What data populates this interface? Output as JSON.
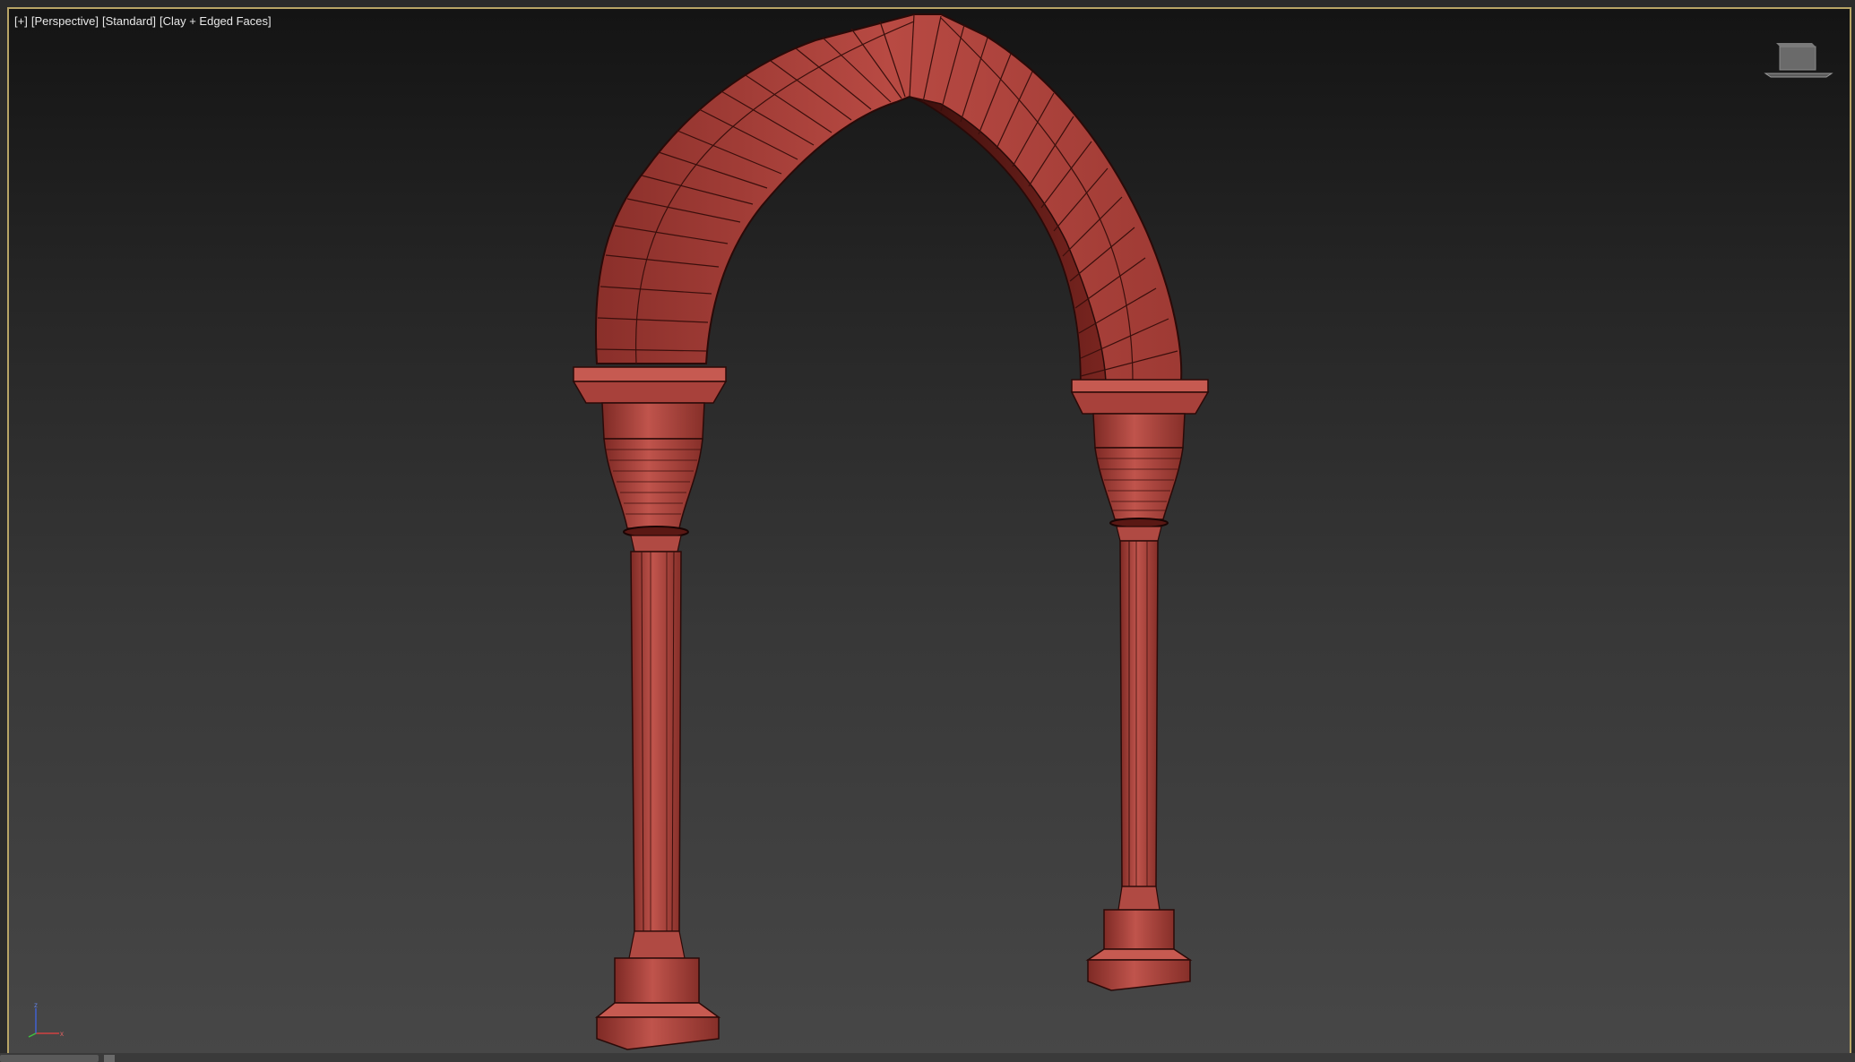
{
  "viewport": {
    "label_parts": [
      "[+]",
      "[Perspective]",
      "[Standard]",
      "[Clay + Edged Faces]"
    ],
    "border_color": "#b8a566",
    "model_color": "#a8413b",
    "model_edge_color": "#2a0a08"
  },
  "viewcube": {
    "icon": "viewcube-icon"
  },
  "gizmo": {
    "icon": "axis-gizmo-icon",
    "axes": [
      "x",
      "y",
      "z"
    ]
  }
}
